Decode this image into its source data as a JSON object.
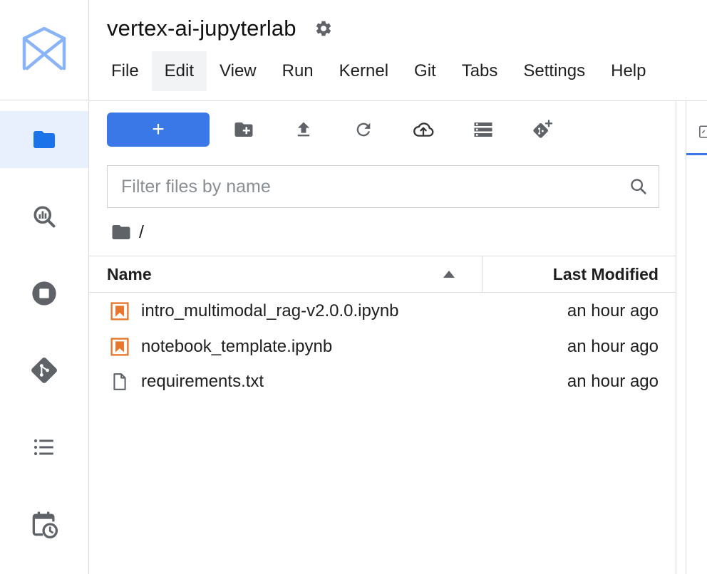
{
  "app": {
    "title": "vertex-ai-jupyterlab",
    "logo_icon": "vertex-ai-logo-icon"
  },
  "menubar": {
    "items": [
      "File",
      "Edit",
      "View",
      "Run",
      "Kernel",
      "Git",
      "Tabs",
      "Settings",
      "Help"
    ],
    "active": "Edit"
  },
  "activity_bar": {
    "items": [
      {
        "icon": "folder-icon",
        "active": true
      },
      {
        "icon": "bigquery-search-icon",
        "active": false
      },
      {
        "icon": "stop-circle-icon",
        "active": false
      },
      {
        "icon": "git-icon",
        "active": false
      },
      {
        "icon": "list-icon",
        "active": false
      },
      {
        "icon": "calendar-clock-icon",
        "active": false
      }
    ]
  },
  "toolbar": {
    "new_label": "+",
    "buttons": [
      "new-folder-icon",
      "upload-icon",
      "refresh-icon",
      "cloud-upload-icon",
      "storage-icon",
      "git-clone-icon"
    ]
  },
  "filter": {
    "placeholder": "Filter files by name"
  },
  "breadcrumb": {
    "path": "/"
  },
  "file_list": {
    "header": {
      "name": "Name",
      "last_modified": "Last Modified"
    },
    "files": [
      {
        "name": "intro_multimodal_rag-v2.0.0.ipynb",
        "modified": "an hour ago",
        "type": "notebook"
      },
      {
        "name": "notebook_template.ipynb",
        "modified": "an hour ago",
        "type": "notebook"
      },
      {
        "name": "requirements.txt",
        "modified": "an hour ago",
        "type": "text"
      }
    ]
  },
  "colors": {
    "accent": "#3b78e7",
    "active_bg": "#e8f0fe",
    "notebook_orange": "#e8772e",
    "icon_gray": "#5f6368",
    "logo_blue": "#8ab4f8"
  }
}
